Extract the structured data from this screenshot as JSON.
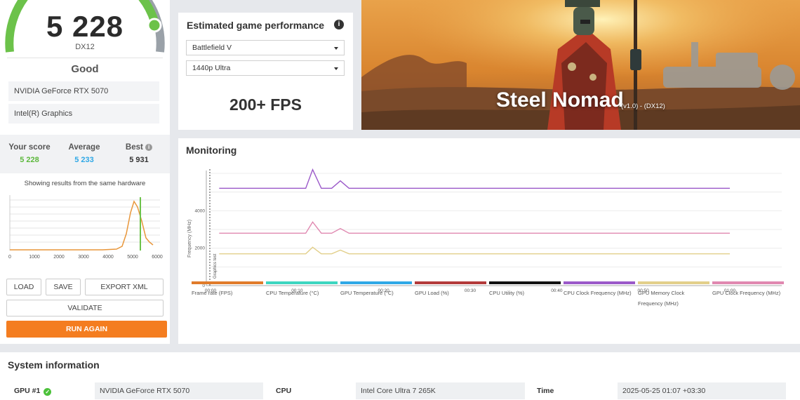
{
  "score": {
    "value": "5 228",
    "api": "DX12",
    "rating": "Good"
  },
  "hardware": {
    "gpu": "NVIDIA GeForce RTX 5070",
    "cpu_graphics": "Intel(R) Graphics"
  },
  "comparison": {
    "your_label": "Your score",
    "your_value": "5 228",
    "avg_label": "Average",
    "avg_value": "5 233",
    "best_label": "Best",
    "best_value": "5 931",
    "note": "Showing results from the same hardware",
    "x_ticks": [
      "0",
      "1000",
      "2000",
      "3000",
      "4000",
      "5000",
      "6000"
    ]
  },
  "buttons": {
    "load": "LOAD",
    "save": "SAVE",
    "export": "EXPORT XML",
    "validate": "VALIDATE",
    "run": "RUN AGAIN"
  },
  "estimated": {
    "title": "Estimated game performance",
    "game": "Battlefield V",
    "preset": "1440p Ultra",
    "fps": "200+ FPS"
  },
  "banner": {
    "title": "Steel Nomad",
    "version": "(v1.0) - (DX12)"
  },
  "monitoring": {
    "title": "Monitoring",
    "legend": [
      {
        "label": "Frame rate (FPS)",
        "color": "#e07b2a"
      },
      {
        "label": "CPU Temperature (°C)",
        "color": "#3dd6c0"
      },
      {
        "label": "GPU Temperature (°C)",
        "color": "#2fa8e6"
      },
      {
        "label": "GPU Load (%)",
        "color": "#b33a3a"
      },
      {
        "label": "CPU Utility (%)",
        "color": "#111111"
      },
      {
        "label": "CPU Clock Frequency (MHz)",
        "color": "#9b59c9"
      },
      {
        "label": "GPU Memory Clock Frequency (MHz)",
        "color": "#e2cf8a"
      },
      {
        "label": "GPU Clock Frequency (MHz)",
        "color": "#e088b0"
      }
    ]
  },
  "chart_data": {
    "type": "line",
    "ylabel": "Frequency (MHz)",
    "annotation": "Graphics test",
    "x_ticks": [
      "00:00",
      "00:10",
      "00:20",
      "00:30",
      "00:40",
      "00:50",
      "01:00"
    ],
    "y_ticks": [
      0,
      2000,
      4000
    ],
    "ylim": [
      0,
      6000
    ],
    "series": [
      {
        "name": "CPU Clock Frequency (MHz)",
        "color": "#9b59c9",
        "x": [
          1,
          11,
          11.8,
          12.8,
          14,
          15,
          16,
          60
        ],
        "y": [
          5200,
          5200,
          6200,
          5200,
          5200,
          5600,
          5200,
          5200
        ]
      },
      {
        "name": "GPU Clock Frequency (MHz)",
        "color": "#e088b0",
        "x": [
          1,
          11,
          11.8,
          12.8,
          14,
          15,
          16,
          60
        ],
        "y": [
          2800,
          2800,
          3400,
          2800,
          2800,
          3050,
          2800,
          2800
        ]
      },
      {
        "name": "GPU Memory Clock Frequency (MHz)",
        "color": "#e2cf8a",
        "x": [
          1,
          11,
          11.8,
          12.8,
          14,
          15,
          16,
          60
        ],
        "y": [
          1700,
          1700,
          2050,
          1700,
          1700,
          1900,
          1700,
          1700
        ]
      }
    ]
  },
  "system": {
    "title": "System information",
    "gpu_label": "GPU #1",
    "gpu_value": "NVIDIA GeForce RTX 5070",
    "cpu_label": "CPU",
    "cpu_value": "Intel Core Ultra 7 265K",
    "time_label": "Time",
    "time_value": "2025-05-25 01:07 +03:30"
  }
}
